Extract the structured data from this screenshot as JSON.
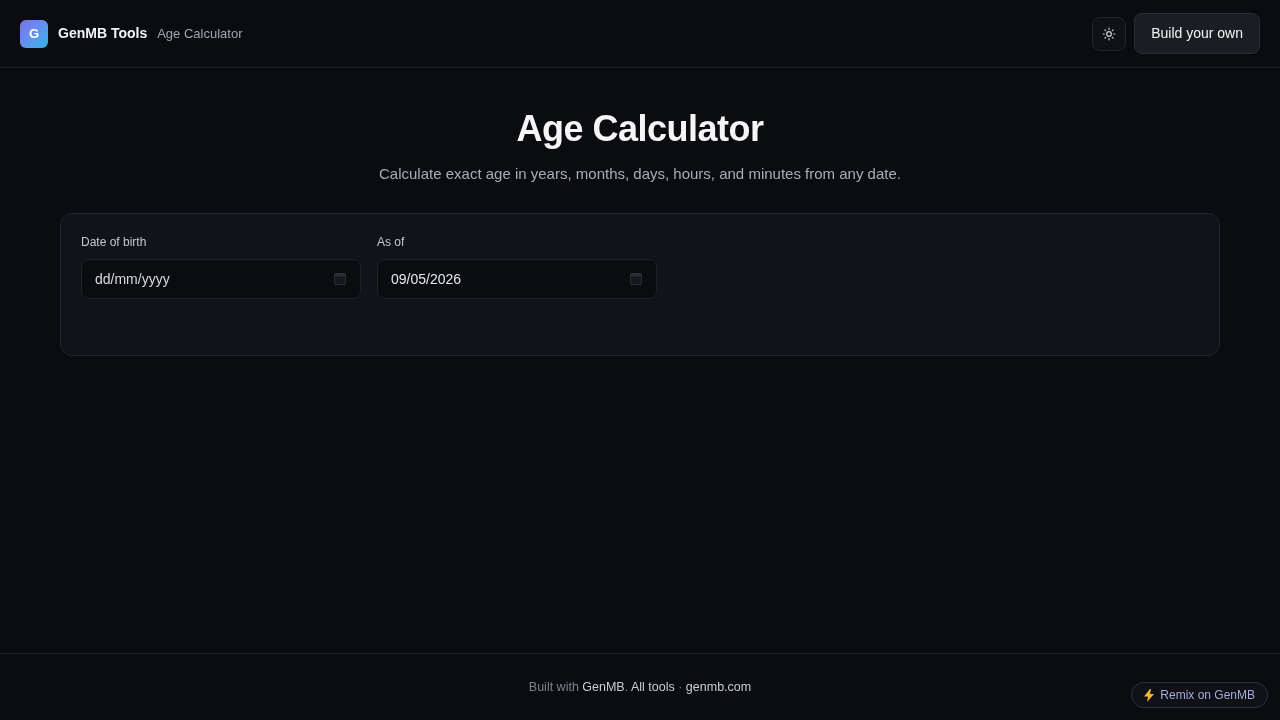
{
  "header": {
    "logo_letter": "G",
    "brand": "GenMB Tools",
    "page_name": "Age Calculator",
    "build_button": "Build your own"
  },
  "hero": {
    "title": "Age Calculator",
    "subtitle": "Calculate exact age in years, months, days, hours, and minutes from any date."
  },
  "form": {
    "fields": [
      {
        "label": "Date of birth",
        "placeholder": "dd/mm/yyyy"
      },
      {
        "label": "As of",
        "value": "09/05/2026"
      }
    ]
  },
  "footer": {
    "parts": [
      {
        "kind": "text",
        "text": "Built with "
      },
      {
        "kind": "link",
        "text": "GenMB"
      },
      {
        "kind": "text",
        "text": ". "
      },
      {
        "kind": "link",
        "text": "All tools"
      },
      {
        "kind": "text",
        "text": " · "
      },
      {
        "kind": "link",
        "text": "genmb.com"
      }
    ]
  },
  "remix_button": "Remix on GenMB"
}
